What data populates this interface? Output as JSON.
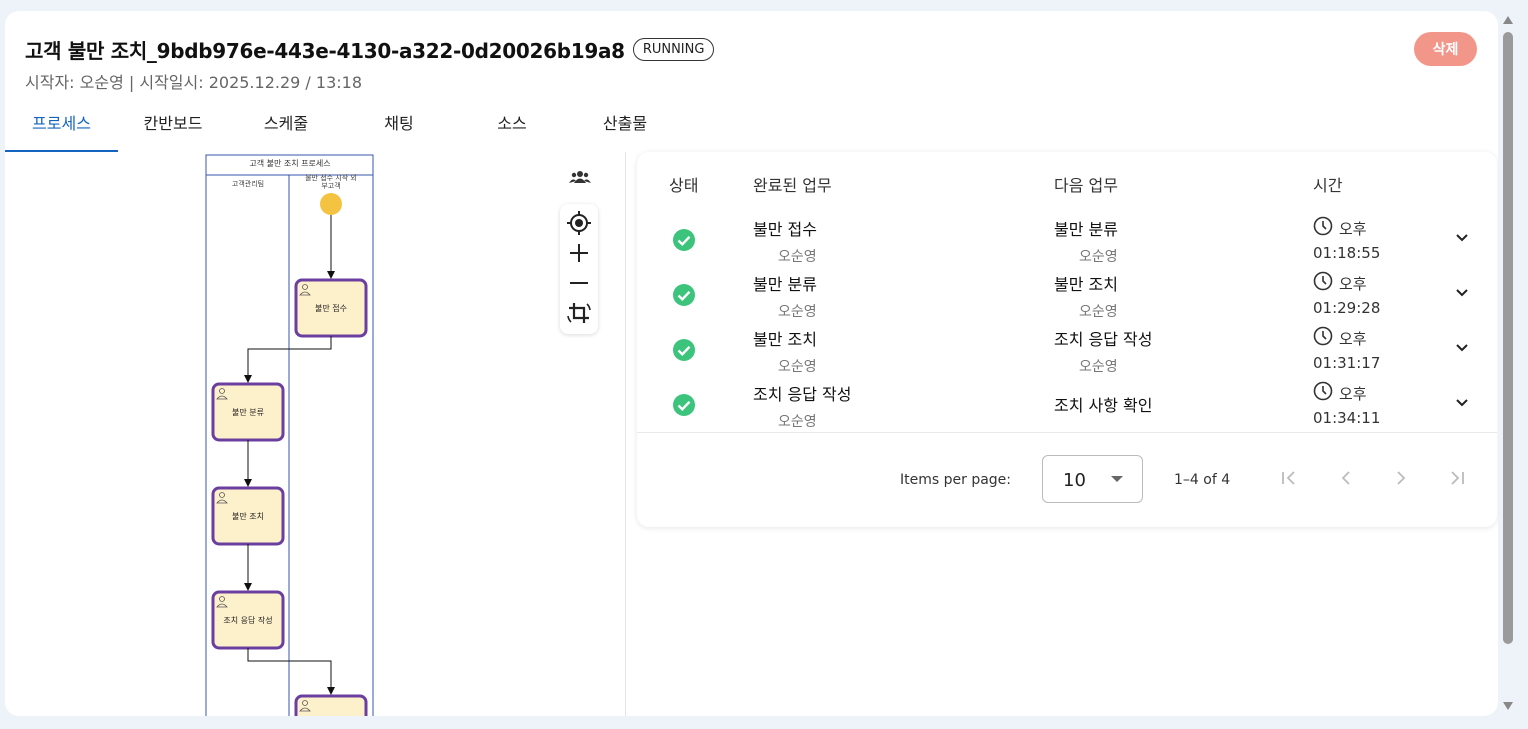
{
  "header": {
    "title": "고객 불만 조치_9bdb976e-443e-4130-a322-0d20026b19a8",
    "status": "RUNNING",
    "subtitle": "시작자: 오순영 | 시작일시: 2025.12.29 / 13:18",
    "delete_label": "삭제"
  },
  "tabs": [
    {
      "label": "프로세스",
      "active": true
    },
    {
      "label": "칸반보드"
    },
    {
      "label": "스케줄"
    },
    {
      "label": "채팅"
    },
    {
      "label": "소스"
    },
    {
      "label": "산출물"
    }
  ],
  "diagram": {
    "pool_title": "고객 불만 조치 프로세스",
    "lanes": [
      "고객관리팀",
      "불만 접수 시작 외부고객"
    ],
    "tasks": [
      "불만 접수",
      "불만 분류",
      "불만 조치",
      "조치 응답 작성"
    ]
  },
  "table": {
    "headers": {
      "status": "상태",
      "completed": "완료된 업무",
      "next": "다음 업무",
      "time": "시간"
    },
    "rows": [
      {
        "completed": "불만 접수",
        "completed_user": "오순영",
        "next": "불만 분류",
        "next_user": "오순영",
        "ampm": "오후",
        "time": "01:18:55"
      },
      {
        "completed": "불만 분류",
        "completed_user": "오순영",
        "next": "불만 조치",
        "next_user": "오순영",
        "ampm": "오후",
        "time": "01:29:28"
      },
      {
        "completed": "불만 조치",
        "completed_user": "오순영",
        "next": "조치 응답 작성",
        "next_user": "오순영",
        "ampm": "오후",
        "time": "01:31:17"
      },
      {
        "completed": "조치 응답 작성",
        "completed_user": "오순영",
        "next": "조치 사항 확인",
        "next_user": "",
        "ampm": "오후",
        "time": "01:34:11"
      }
    ]
  },
  "pagination": {
    "items_per_page_label": "Items per page:",
    "page_size": "10",
    "range": "1–4 of 4"
  },
  "colors": {
    "accent": "#1565c0",
    "success": "#3cc47c",
    "delete": "#f3968a",
    "task_border": "#6b3fa0",
    "task_fill": "#fdf1cc",
    "start_event": "#f5c342"
  }
}
